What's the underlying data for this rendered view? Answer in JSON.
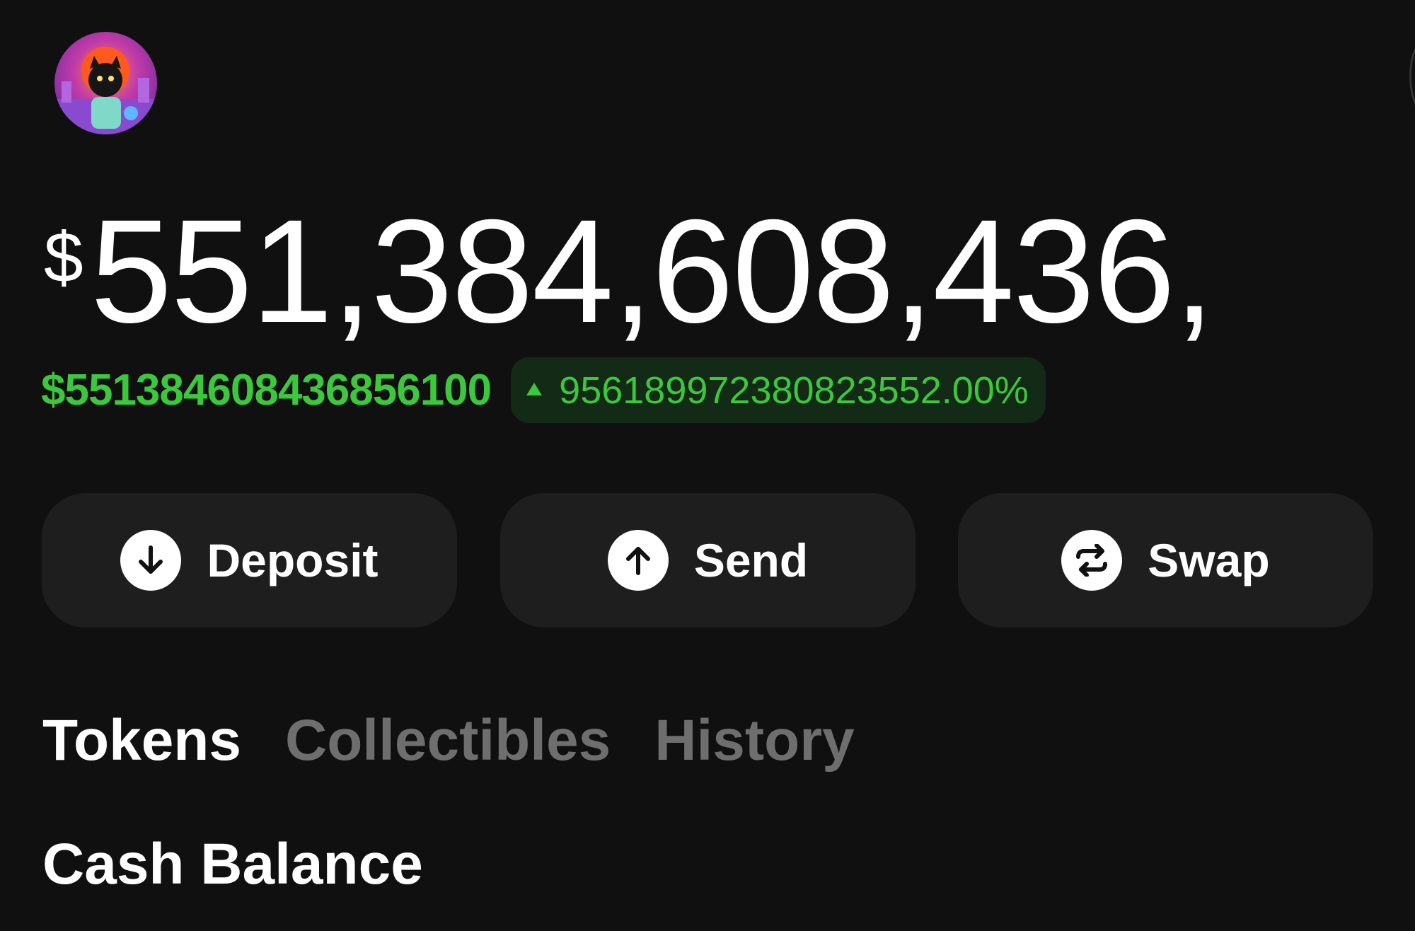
{
  "header": {
    "avatar_alt": "profile-avatar"
  },
  "balance": {
    "currency_symbol": "$",
    "amount": "551,384,608,436,"
  },
  "change": {
    "amount": "$551384608436856100",
    "percent": "95618997238082355​2.00%"
  },
  "actions": [
    {
      "label": "Deposit",
      "icon": "arrow-down-icon"
    },
    {
      "label": "Send",
      "icon": "arrow-up-icon"
    },
    {
      "label": "Swap",
      "icon": "swap-arrows-icon"
    }
  ],
  "tabs": [
    {
      "label": "Tokens",
      "active": true
    },
    {
      "label": "Collectibles",
      "active": false
    },
    {
      "label": "History",
      "active": false
    }
  ],
  "section": {
    "title": "Cash Balance"
  },
  "colors": {
    "background": "#101010",
    "positive": "#3cc83c",
    "button_bg": "#1e1e1e",
    "inactive_tab": "#6e6e6e"
  }
}
